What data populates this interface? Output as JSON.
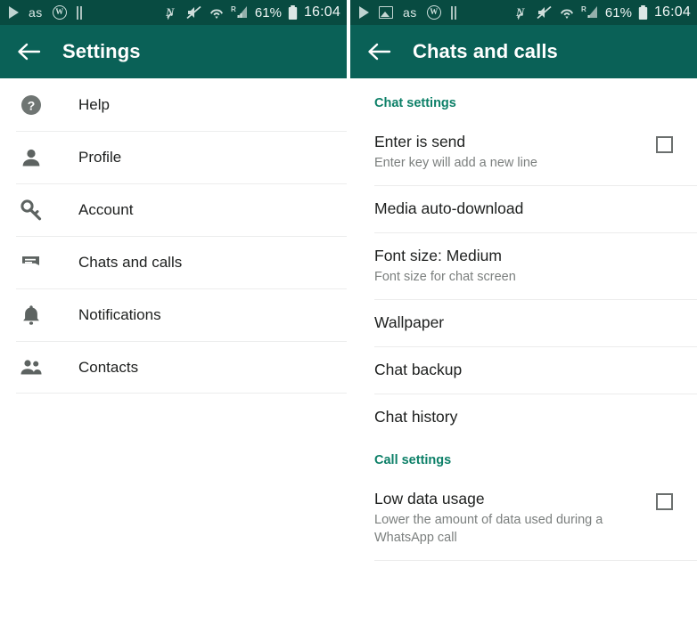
{
  "colors": {
    "statusbar": "#084b41",
    "appbar": "#0a6157",
    "section_header": "#0d8068",
    "primary_text": "#1d1f1e",
    "secondary_text": "#7b7f7e",
    "divider": "#ececec",
    "icon_gray": "#5d6361"
  },
  "left_screen": {
    "statusbar": {
      "left_icons": [
        "play-icon",
        "lastfm-icon",
        "w-badge-icon",
        "pause-icon"
      ],
      "lastfm_label": "as",
      "w_badge_label": "W",
      "right_icons": [
        "nfc-icon",
        "mute-icon",
        "wifi-icon",
        "roaming-signal-icon"
      ],
      "nfc_label": "N",
      "roaming_label": "R",
      "battery": "61%",
      "time": "16:04"
    },
    "appbar": {
      "back_icon": "back-arrow-icon",
      "title": "Settings"
    },
    "items": [
      {
        "label": "Help",
        "icon": "help-circle-icon"
      },
      {
        "label": "Profile",
        "icon": "person-icon"
      },
      {
        "label": "Account",
        "icon": "key-icon"
      },
      {
        "label": "Chats and calls",
        "icon": "chat-bubble-icon"
      },
      {
        "label": "Notifications",
        "icon": "bell-icon"
      },
      {
        "label": "Contacts",
        "icon": "contacts-icon"
      }
    ]
  },
  "right_screen": {
    "statusbar": {
      "left_icons": [
        "play-icon",
        "image-icon",
        "lastfm-icon",
        "w-badge-icon",
        "pause-icon"
      ],
      "lastfm_label": "as",
      "w_badge_label": "W",
      "right_icons": [
        "nfc-icon",
        "mute-icon",
        "wifi-icon",
        "roaming-signal-icon"
      ],
      "nfc_label": "N",
      "roaming_label": "R",
      "battery": "61%",
      "time": "16:04"
    },
    "appbar": {
      "back_icon": "back-arrow-icon",
      "title": "Chats and calls"
    },
    "sections": [
      {
        "header": "Chat settings",
        "rows": [
          {
            "title": "Enter is send",
            "subtitle": "Enter key will add a new line",
            "checkbox": "unchecked"
          },
          {
            "title": "Media auto-download",
            "subtitle": ""
          },
          {
            "title": "Font size: Medium",
            "subtitle": "Font size for chat screen"
          },
          {
            "title": "Wallpaper",
            "subtitle": ""
          },
          {
            "title": "Chat backup",
            "subtitle": ""
          },
          {
            "title": "Chat history",
            "subtitle": ""
          }
        ]
      },
      {
        "header": "Call settings",
        "rows": [
          {
            "title": "Low data usage",
            "subtitle": "Lower the amount of data used during a WhatsApp call",
            "checkbox": "unchecked"
          }
        ]
      }
    ]
  }
}
